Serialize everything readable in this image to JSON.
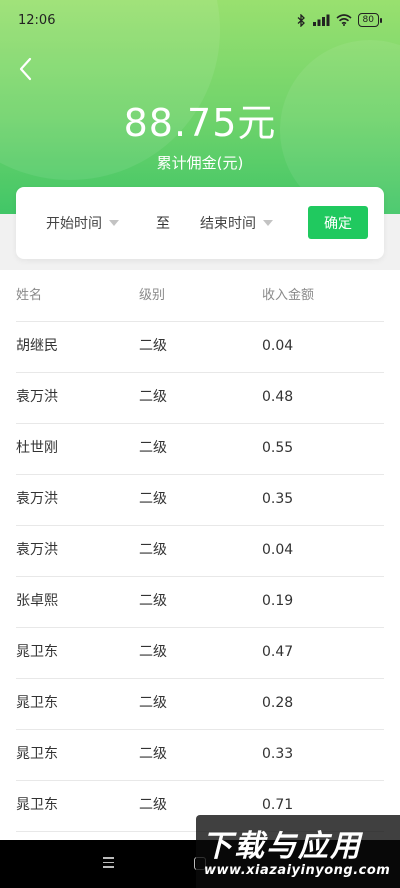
{
  "status_bar": {
    "time": "12:06",
    "battery_level": "80",
    "icons": [
      "bluetooth-icon",
      "signal-icon",
      "wifi-icon",
      "battery-icon"
    ]
  },
  "header": {
    "amount": "88.75元",
    "amount_label": "累计佣金(元)",
    "back_icon": "chevron-left-icon"
  },
  "filter": {
    "start_label": "开始时间",
    "separator": "至",
    "end_label": "结束时间",
    "confirm_label": "确定"
  },
  "table": {
    "columns": [
      "姓名",
      "级别",
      "收入金额"
    ],
    "rows": [
      [
        "胡继民",
        "二级",
        "0.04"
      ],
      [
        "袁万洪",
        "二级",
        "0.48"
      ],
      [
        "杜世刚",
        "二级",
        "0.55"
      ],
      [
        "袁万洪",
        "二级",
        "0.35"
      ],
      [
        "袁万洪",
        "二级",
        "0.04"
      ],
      [
        "张卓熙",
        "二级",
        "0.19"
      ],
      [
        "晁卫东",
        "二级",
        "0.47"
      ],
      [
        "晁卫东",
        "二级",
        "0.28"
      ],
      [
        "晁卫东",
        "二级",
        "0.33"
      ],
      [
        "晁卫东",
        "二级",
        "0.71"
      ]
    ]
  },
  "watermark": {
    "title": "下载与应用",
    "url": "www.xiazaiyinyong.com"
  },
  "colors": {
    "header_gradient_top": "#99e06f",
    "header_gradient_bottom": "#41c667",
    "confirm_button": "#20c95f"
  }
}
